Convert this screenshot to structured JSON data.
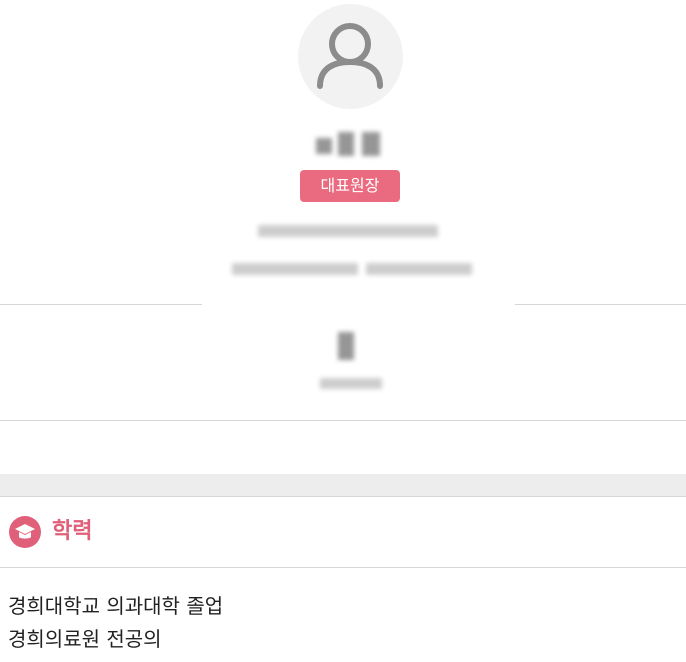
{
  "profile": {
    "avatar_icon": "user-icon",
    "role_badge": "대표원장",
    "badge_color": "#ea6b80"
  },
  "education": {
    "icon": "graduation-cap-icon",
    "title": "학력",
    "accent_color": "#e0607a",
    "items": [
      "경희대학교 의과대학 졸업",
      "경희의료원 전공의"
    ]
  }
}
